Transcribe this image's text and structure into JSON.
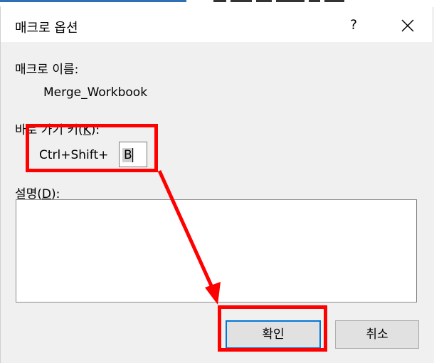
{
  "dialog": {
    "title": "매크로 옵션",
    "help_label": "?",
    "macro_name_label": "매크로 이름:",
    "macro_name_value": "Merge_Workbook",
    "shortcut_label_prefix": "바로 가기 키(",
    "shortcut_label_key": "K",
    "shortcut_label_suffix": "):",
    "shortcut_modifier": "Ctrl+Shift+",
    "shortcut_key_value": "B",
    "description_label_prefix": "설명(",
    "description_label_key": "D",
    "description_label_suffix": "):",
    "description_value": "",
    "ok_label": "확인",
    "cancel_label": "취소"
  },
  "colors": {
    "highlight": "#ff0000",
    "focus_border": "#0078d7",
    "dialog_bg": "#f0f0f0"
  },
  "icons": [
    "close-icon"
  ]
}
